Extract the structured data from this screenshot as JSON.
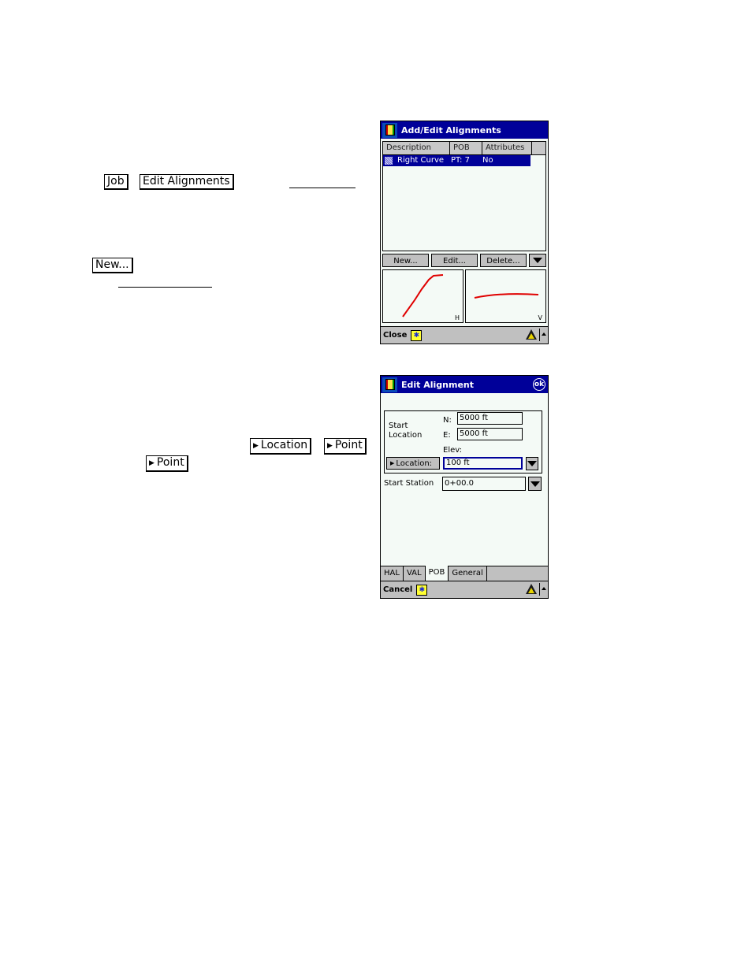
{
  "document": {
    "keys_line1": [
      "Job",
      "Edit Alignments"
    ],
    "key_new": "New...",
    "keys_line2": [
      "Location",
      "Point"
    ],
    "key_point": "Point"
  },
  "screen1": {
    "title": "Add/Edit Alignments",
    "columns": [
      "Description",
      "POB",
      "Attributes"
    ],
    "rows": [
      {
        "description": "Right Curve",
        "pob": "PT: 7",
        "attributes": "No",
        "selected": true
      }
    ],
    "buttons": {
      "new": "New...",
      "edit": "Edit...",
      "delete": "Delete..."
    },
    "preview_labels": {
      "horizontal": "H",
      "vertical": "V"
    },
    "bottom": {
      "close": "Close"
    }
  },
  "screen2": {
    "title": "Edit Alignment",
    "ok": "ok",
    "start_location_label": "Start Location",
    "n_label": "N:",
    "n_value": "5000 ft",
    "e_label": "E:",
    "e_value": "5000 ft",
    "elev_label": "Elev:",
    "elev_value": "100 ft",
    "location_button": "Location:",
    "start_station_label": "Start Station",
    "start_station_value": "0+00.0",
    "tabs": [
      "HAL",
      "VAL",
      "POB",
      "General"
    ],
    "active_tab": "POB",
    "bottom": {
      "cancel": "Cancel"
    }
  },
  "colors": {
    "titlebar": "#000099",
    "curve": "#e00000",
    "selection": "#000099"
  }
}
